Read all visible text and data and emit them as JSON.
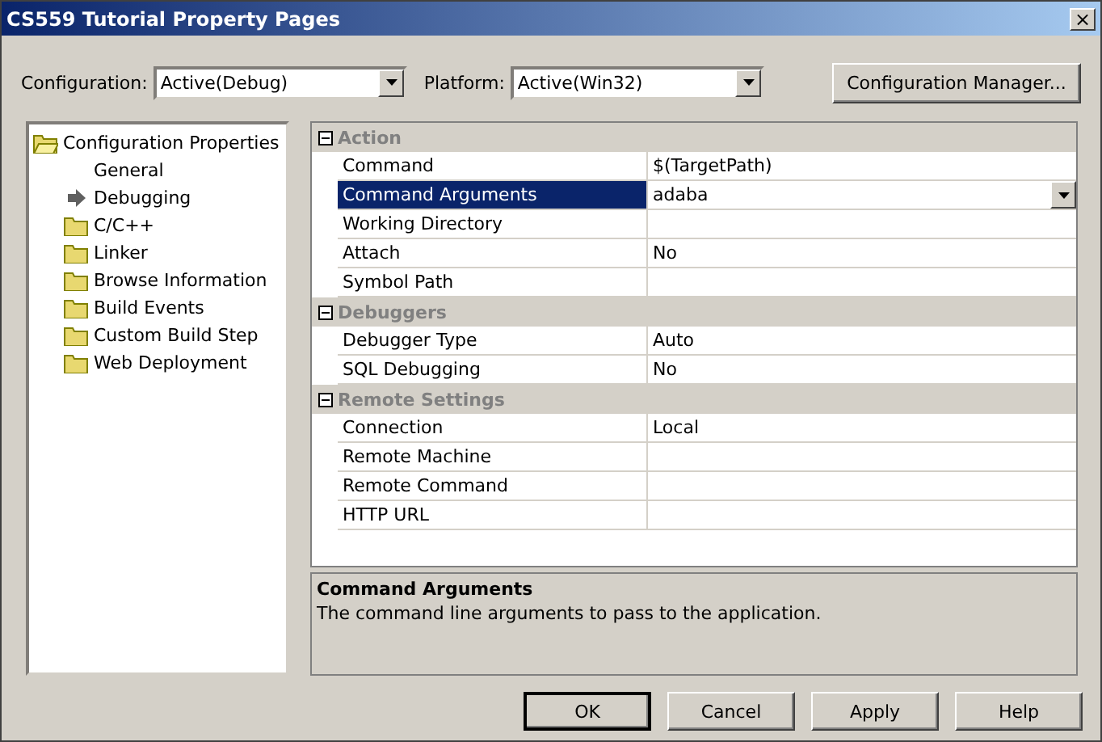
{
  "window": {
    "title": "CS559 Tutorial Property Pages",
    "close": "×"
  },
  "toolbar": {
    "configuration": {
      "label": "Configuration:",
      "value": "Active(Debug)"
    },
    "platform": {
      "label": "Platform:",
      "value": "Active(Win32)"
    },
    "manager_button": "Configuration Manager..."
  },
  "tree": {
    "label": "Configuration Properties",
    "kind": "open-folder",
    "children": [
      {
        "label": "General",
        "kind": "none"
      },
      {
        "label": "Debugging",
        "kind": "arrow"
      },
      {
        "label": "C/C++",
        "kind": "folder"
      },
      {
        "label": "Linker",
        "kind": "folder"
      },
      {
        "label": "Browse Information",
        "kind": "folder"
      },
      {
        "label": "Build Events",
        "kind": "folder"
      },
      {
        "label": "Custom Build Step",
        "kind": "folder"
      },
      {
        "label": "Web Deployment",
        "kind": "folder"
      }
    ]
  },
  "grid": [
    {
      "category": "Action",
      "expanded": true,
      "rows": [
        {
          "name": "Command",
          "value": "$(TargetPath)",
          "selected": false
        },
        {
          "name": "Command Arguments",
          "value": "adaba",
          "selected": true
        },
        {
          "name": "Working Directory",
          "selected": false
        },
        {
          "name": "Attach",
          "value": "No",
          "selected": false
        },
        {
          "name": "Symbol Path",
          "selected": false
        }
      ]
    },
    {
      "category": "Debuggers",
      "expanded": true,
      "rows": [
        {
          "name": "Debugger Type",
          "value": "Auto",
          "selected": false
        },
        {
          "name": "SQL Debugging",
          "value": "No",
          "selected": false
        }
      ]
    },
    {
      "category": "Remote Settings",
      "expanded": true,
      "rows": [
        {
          "name": "Connection",
          "value": "Local",
          "selected": false
        },
        {
          "name": "Remote Machine",
          "selected": false
        },
        {
          "name": "Remote Command",
          "selected": false
        },
        {
          "name": "HTTP URL",
          "selected": false
        }
      ]
    }
  ],
  "description": {
    "title": "Command Arguments",
    "text": "The command line arguments to pass to the application."
  },
  "buttons": [
    {
      "label": "OK",
      "default": true
    },
    {
      "label": "Cancel",
      "default": false
    },
    {
      "label": "Apply",
      "default": false
    },
    {
      "label": "Help",
      "default": false
    }
  ]
}
